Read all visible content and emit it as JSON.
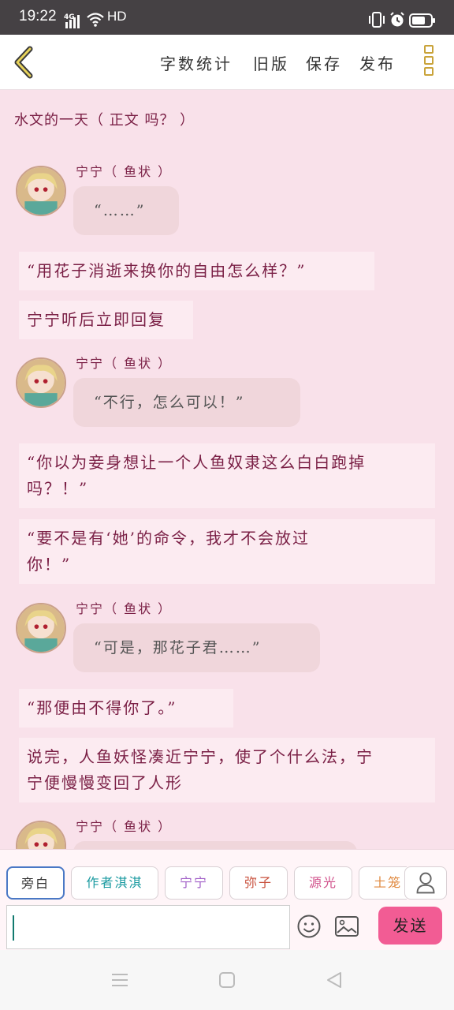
{
  "status_bar": {
    "time": "19:22",
    "network": "4G",
    "hd_label": "HD"
  },
  "header": {
    "actions": [
      "字数统计",
      "旧版",
      "保存",
      "发布"
    ]
  },
  "document": {
    "title": "水文的一天（ 正文 吗？ ）"
  },
  "messages": [
    {
      "type": "character",
      "name": "宁宁（ 鱼状 ）",
      "text": "“……”"
    },
    {
      "type": "narration",
      "text": "“用花子消逝来换你的自由怎么样？”"
    },
    {
      "type": "narration",
      "text": "宁宁听后立即回复"
    },
    {
      "type": "character",
      "name": "宁宁（ 鱼状 ）",
      "text": "“不行，怎么可以！”"
    },
    {
      "type": "narration",
      "lines": [
        "“你以为妾身想让一个人鱼奴隶这么白白跑掉",
        "吗？！”"
      ]
    },
    {
      "type": "narration",
      "lines": [
        "“要不是有‘她’的命令，我才不会放过",
        "你！”"
      ]
    },
    {
      "type": "character",
      "name": "宁宁（ 鱼状 ）",
      "text": "“可是，那花子君……”"
    },
    {
      "type": "narration",
      "text": "“那便由不得你了。”"
    },
    {
      "type": "narration",
      "lines": [
        "说完，人鱼妖怪凑近宁宁，使了个什么法，宁",
        "宁便慢慢变回了人形"
      ]
    },
    {
      "type": "character",
      "name": "宁宁（ 鱼状 ）",
      "text": ""
    }
  ],
  "composer": {
    "roles": [
      {
        "label": "旁白",
        "color": "#333333",
        "selected": true
      },
      {
        "label": "作者淇淇",
        "color": "#1a9aa0",
        "selected": false
      },
      {
        "label": "宁宁",
        "color": "#a260c8",
        "selected": false
      },
      {
        "label": "弥子",
        "color": "#c8503c",
        "selected": false
      },
      {
        "label": "源光",
        "color": "#d0508a",
        "selected": false
      },
      {
        "label": "土笼",
        "color": "#e08a40",
        "selected": false
      }
    ],
    "input_value": "",
    "send_label": "发送"
  },
  "colors": {
    "accent_pink": "#f25c94",
    "text_maroon": "#7a1f45",
    "background": "#f9e1ea"
  }
}
